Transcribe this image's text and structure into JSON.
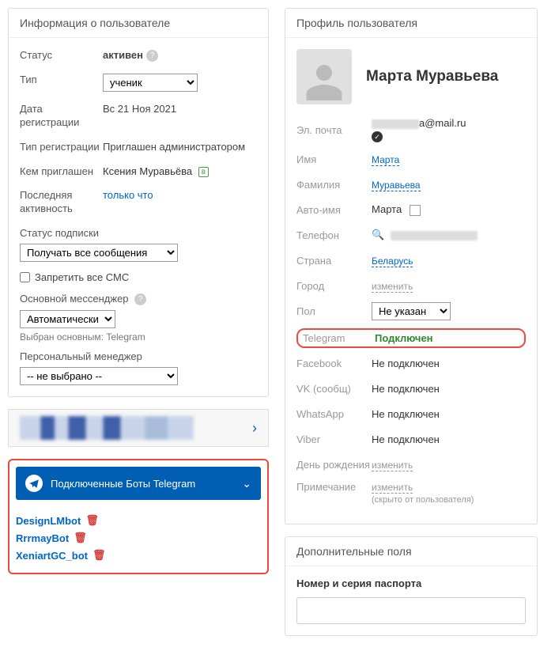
{
  "userInfo": {
    "title": "Информация о пользователе",
    "status": {
      "label": "Статус",
      "value": "активен"
    },
    "type": {
      "label": "Тип",
      "value": "ученик"
    },
    "regDate": {
      "label": "Дата регистрации",
      "value": "Вс 21 Ноя 2021"
    },
    "regType": {
      "label": "Тип регистрации",
      "value": "Приглашен администратором"
    },
    "invitedBy": {
      "label": "Кем приглашен",
      "value": "Ксения Муравьёва",
      "badge": "в"
    },
    "lastActivity": {
      "label": "Последняя активность",
      "value": "только что"
    },
    "subStatus": {
      "label": "Статус подписки",
      "value": "Получать все сообщения"
    },
    "blockSms": "Запретить все СМС",
    "mainMessenger": {
      "label": "Основной мессенджер",
      "value": "Автоматически",
      "hint": "Выбран основным: Telegram"
    },
    "personalManager": {
      "label": "Персональный менеджер",
      "value": "-- не выбрано --"
    }
  },
  "telegramBots": {
    "title": "Подключенные Боты Telegram",
    "bots": [
      "DesignLMbot",
      "RrrmayBot",
      "XeniartGC_bot"
    ]
  },
  "profile": {
    "title": "Профиль пользователя",
    "name": "Марта Муравьева",
    "emailLabel": "Эл. почта",
    "emailSuffix": "a@mail.ru",
    "firstName": {
      "label": "Имя",
      "value": "Марта"
    },
    "lastName": {
      "label": "Фамилия",
      "value": "Муравьева"
    },
    "autoName": {
      "label": "Авто-имя",
      "value": "Марта"
    },
    "phone": {
      "label": "Телефон"
    },
    "country": {
      "label": "Страна",
      "value": "Беларусь"
    },
    "city": {
      "label": "Город",
      "value": "изменить"
    },
    "gender": {
      "label": "Пол",
      "value": "Не указан"
    },
    "telegram": {
      "label": "Telegram",
      "value": "Подключен"
    },
    "facebook": {
      "label": "Facebook",
      "value": "Не подключен"
    },
    "vk": {
      "label": "VK (сообщ)",
      "value": "Не подключен"
    },
    "whatsapp": {
      "label": "WhatsApp",
      "value": "Не подключен"
    },
    "viber": {
      "label": "Viber",
      "value": "Не подключен"
    },
    "birthday": {
      "label": "День рождения",
      "value": "изменить"
    },
    "note": {
      "label": "Примечание",
      "value": "изменить",
      "hint": "(скрыто от пользователя)"
    }
  },
  "additional": {
    "title": "Дополнительные поля",
    "passport": "Номер и серия паспорта"
  }
}
